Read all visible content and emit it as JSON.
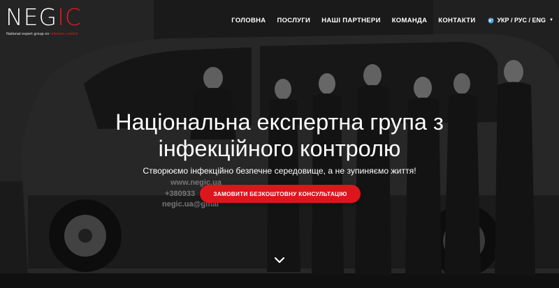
{
  "logo": {
    "text_main": "NEG",
    "text_accent": "IC",
    "tagline_main": "National expert group on ",
    "tagline_accent": "infection control"
  },
  "nav": {
    "items": [
      {
        "label": "ГОЛОВНА"
      },
      {
        "label": "ПОСЛУГИ"
      },
      {
        "label": "НАШІ ПАРТНЕРИ"
      },
      {
        "label": "КОМАНДА"
      },
      {
        "label": "КОНТАКТИ"
      }
    ],
    "language": {
      "label": "УКР / РУС / ENG",
      "icon": "globe-icon",
      "caret_icon": "caret-down-icon"
    }
  },
  "hero": {
    "title_line1": "Національна експертна група з",
    "title_line2": "інфекційного контролю",
    "subtitle": "Створюємо інфекційно безпечне середовище, а не зупиняємо життя!",
    "cta_label": "ЗАМОВИТИ БЕЗКОШТОВНУ КОНСУЛЬТАЦІЮ",
    "scroll_icon": "chevron-down-icon",
    "van_text": [
      "www.negic.ua",
      "+380933",
      "negic.ua@gmai"
    ]
  },
  "colors": {
    "brand_red": "#e21a23",
    "button_red": "#dd151d",
    "text": "#ffffff"
  }
}
